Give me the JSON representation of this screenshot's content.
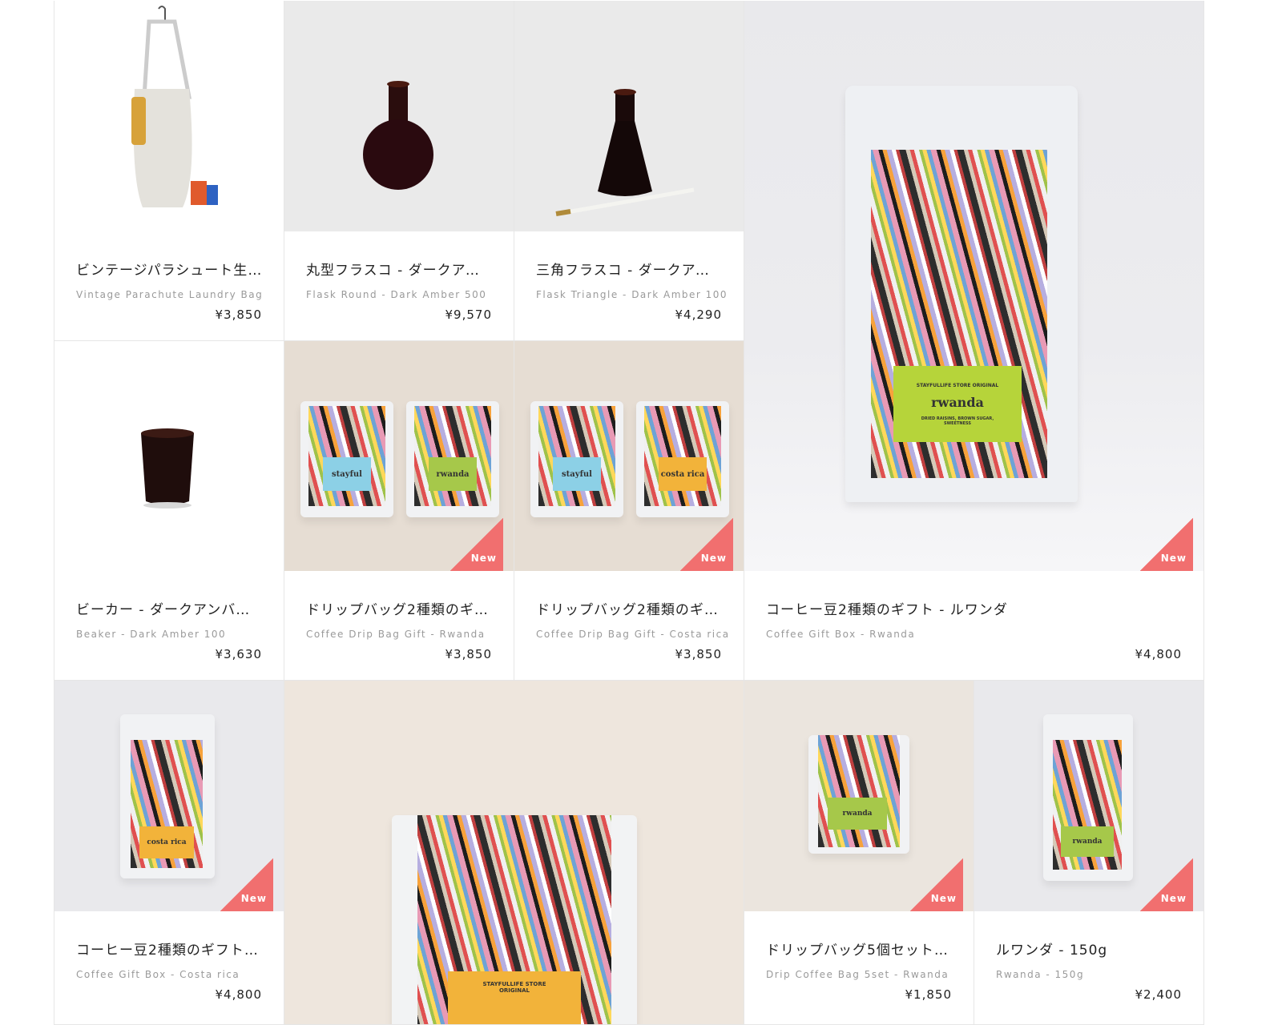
{
  "badge_label": "New",
  "colors": {
    "badge": "#f16f6f",
    "price": "#222222",
    "subtitle": "#9a9a9a",
    "border": "#e6e6e6"
  },
  "products": [
    {
      "title": "ビンテージパラシュート生…",
      "subtitle": "Vintage Parachute Laundry Bag",
      "price": "¥3,850"
    },
    {
      "title": "丸型フラスコ - ダークアン…",
      "subtitle": "Flask Round - Dark Amber 500",
      "price": "¥9,570"
    },
    {
      "title": "三角フラスコ - ダークアン…",
      "subtitle": "Flask Triangle - Dark Amber 100",
      "price": "¥4,290"
    },
    {
      "title": "ビーカー - ダークアンバー 1…",
      "subtitle": "Beaker - Dark Amber 100",
      "price": "¥3,630"
    },
    {
      "title": "ドリップバッグ2種類のギフ…",
      "subtitle": "Coffee Drip Bag Gift - Rwanda",
      "price": "¥3,850",
      "new": true,
      "labels": [
        "stayful",
        "rwanda"
      ]
    },
    {
      "title": "ドリップバッグ2種類のギフ…",
      "subtitle": "Coffee Drip Bag Gift - Costa rica",
      "price": "¥3,850",
      "new": true,
      "labels": [
        "stayful",
        "costa rica"
      ]
    },
    {
      "title": "コーヒー豆2種類のギフト - ルワンダ",
      "subtitle": "Coffee Gift Box - Rwanda",
      "price": "¥4,800",
      "new": true,
      "labels": [
        "STAYFULLIFE STORE ORIGINAL",
        "rwanda",
        "DRIED RAISINS, BROWN SUGAR, SWEETNESS"
      ]
    },
    {
      "title": "コーヒー豆2種類のギフト - …",
      "subtitle": "Coffee Gift Box - Costa rica",
      "price": "¥4,800",
      "new": true,
      "labels": [
        "costa rica"
      ]
    },
    {
      "labels": [
        "STAYFULLIFE STORE ORIGINAL"
      ]
    },
    {
      "title": "ドリップバッグ5個セット - …",
      "subtitle": "Drip Coffee Bag 5set - Rwanda",
      "price": "¥1,850",
      "new": true,
      "labels": [
        "rwanda"
      ]
    },
    {
      "title": "ルワンダ - 150g",
      "subtitle": "Rwanda - 150g",
      "price": "¥2,400",
      "new": true,
      "labels": [
        "rwanda"
      ]
    }
  ]
}
